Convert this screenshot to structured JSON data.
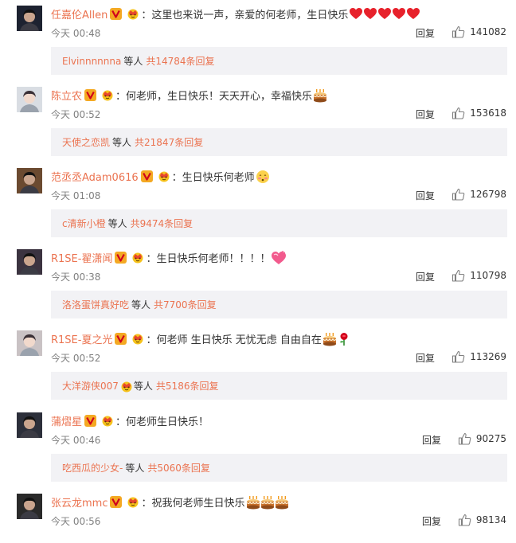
{
  "comments": [
    {
      "username": "任嘉伦Allen",
      "text": "：这里也来说一声，亲爱的何老师，生日快乐",
      "emojis": [
        "heart-emoji",
        "heart-emoji",
        "heart-emoji",
        "heart-emoji",
        "heart-emoji"
      ],
      "time": "今天 00:48",
      "reply_label": "回复",
      "likes": "141082",
      "sub": {
        "user": "Elvinnnnnna",
        "word": "等人",
        "total": "共14784条回复"
      },
      "avatar_color": "#1d2230"
    },
    {
      "username": "陈立农",
      "text": "：何老师，生日快乐！天天开心，幸福快乐",
      "emojis": [
        "cake-emoji"
      ],
      "time": "今天 00:52",
      "reply_label": "回复",
      "likes": "153618",
      "sub": {
        "user": "天使之恋凯",
        "word": "等人",
        "total": "共21847条回复"
      },
      "avatar_color": "#d9dde3"
    },
    {
      "username": "范丞丞Adam0616",
      "text": "：生日快乐何老师",
      "emojis": [
        "shy-face-emoji"
      ],
      "time": "今天 01:08",
      "reply_label": "回复",
      "likes": "126798",
      "sub": {
        "user": "c清新小橙",
        "word": "等人",
        "total": "共9474条回复"
      },
      "avatar_color": "#6b4a30"
    },
    {
      "username": "R1SE-翟潇闻",
      "text": "：生日快乐何老师！！！！",
      "emojis": [
        "heart-gift-emoji"
      ],
      "time": "今天 00:38",
      "reply_label": "回复",
      "likes": "110798",
      "sub": {
        "user": "洛洛蛋饼真好吃",
        "word": "等人",
        "total": "共7700条回复"
      },
      "avatar_color": "#3b3340"
    },
    {
      "username": "R1SE-夏之光",
      "text": "：何老师 生日快乐 无忧无虑 自由自在",
      "emojis": [
        "cake-emoji",
        "rose-emoji"
      ],
      "time": "今天 00:52",
      "reply_label": "回复",
      "likes": "113269",
      "sub": {
        "user": "大洋游侠007",
        "word": "等人",
        "total": "共5186条回复",
        "emoji": "crown-badge"
      },
      "avatar_color": "#c9c2c4"
    },
    {
      "username": "蒲熠星",
      "text": "：何老师生日快乐！",
      "emojis": [],
      "time": "今天 00:46",
      "reply_label": "回复",
      "likes": "90275",
      "sub": {
        "user": "吃西瓜的少女-",
        "word": "等人",
        "total": "共5060条回复"
      },
      "avatar_color": "#2c2f3a"
    },
    {
      "username": "张云龙mmc",
      "text": "：祝我何老师生日快乐",
      "emojis": [
        "cake-emoji",
        "cake-emoji",
        "cake-emoji"
      ],
      "time": "今天 00:56",
      "reply_label": "回复",
      "likes": "98134",
      "sub": null,
      "avatar_color": "#2a2a2a"
    }
  ],
  "colors": {
    "username": "#eb7350",
    "background": "#ffffff",
    "subreply_bg": "#f2f2f5",
    "meta": "#808080"
  }
}
